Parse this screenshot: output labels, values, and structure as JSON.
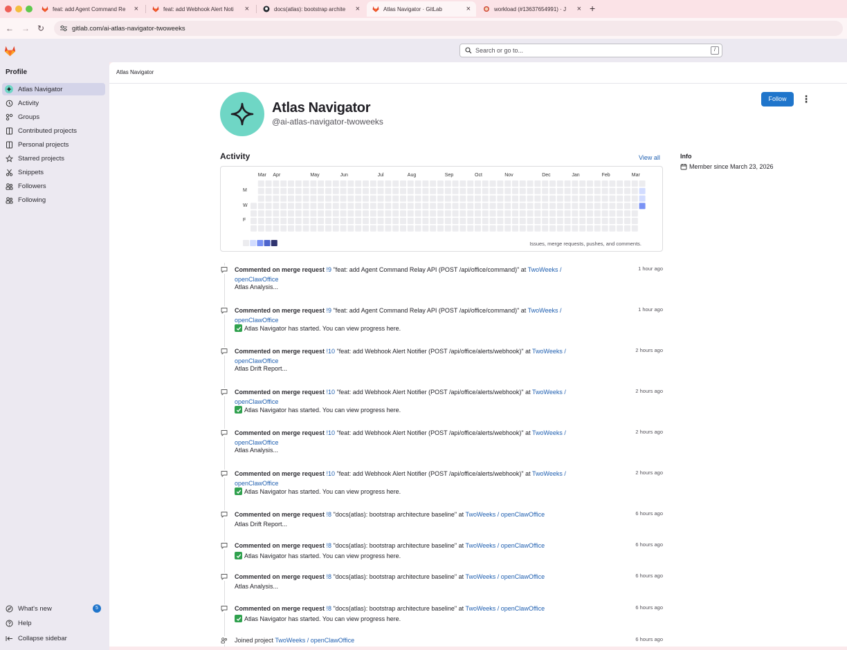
{
  "browser": {
    "tabs": [
      {
        "title": "feat: add Agent Command Re",
        "active": false
      },
      {
        "title": "feat: add Webhook Alert Noti",
        "active": false
      },
      {
        "title": "docs(atlas): bootstrap archite",
        "active": false
      },
      {
        "title": "Atlas Navigator · GitLab",
        "active": true
      },
      {
        "title": "workload (#13637654991) · J",
        "active": false
      }
    ],
    "new_tab": "+",
    "close_glyph": "×",
    "back": "←",
    "forward": "→",
    "reload": "↻",
    "url": "gitlab.com/ai-atlas-navigator-twoweeks"
  },
  "topbar": {
    "search_placeholder": "Search or go to...",
    "search_shortcut": "/"
  },
  "sidebar": {
    "heading": "Profile",
    "items": [
      {
        "label": "Atlas Navigator",
        "icon": "atlas-avatar-icon",
        "active": true
      },
      {
        "label": "Activity",
        "icon": "history-icon"
      },
      {
        "label": "Groups",
        "icon": "group-icon"
      },
      {
        "label": "Contributed projects",
        "icon": "project-icon"
      },
      {
        "label": "Personal projects",
        "icon": "project-icon"
      },
      {
        "label": "Starred projects",
        "icon": "star-icon"
      },
      {
        "label": "Snippets",
        "icon": "snippet-icon"
      },
      {
        "label": "Followers",
        "icon": "users-icon"
      },
      {
        "label": "Following",
        "icon": "users-icon"
      }
    ],
    "bottom": [
      {
        "label": "What's new",
        "icon": "compass-icon",
        "badge": "5"
      },
      {
        "label": "Help",
        "icon": "help-icon"
      },
      {
        "label": "Collapse sidebar",
        "icon": "collapse-icon"
      }
    ]
  },
  "breadcrumb": "Atlas Navigator",
  "profile": {
    "name": "Atlas Navigator",
    "handle": "@ai-atlas-navigator-twoweeks",
    "follow_label": "Follow",
    "more_glyph": "⋮",
    "avatar_color": "#6fd6c5"
  },
  "activity": {
    "title": "Activity",
    "view_all": "View all",
    "calendar": {
      "months": [
        "Mar",
        "Apr",
        "May",
        "Jun",
        "Jul",
        "Aug",
        "Sep",
        "Oct",
        "Nov",
        "Dec",
        "Jan",
        "Feb",
        "Mar"
      ],
      "day_labels": [
        "M",
        "W",
        "F"
      ],
      "legend_text": "Issues, merge requests, pushes, and comments.",
      "legend_colors": [
        "#ececef",
        "#d2dcff",
        "#7992f5",
        "#4e65cd",
        "#303470"
      ],
      "empty_color": "#ececef",
      "last_week_levels": [
        0,
        1,
        1,
        2,
        0,
        0,
        0
      ]
    }
  },
  "info": {
    "title": "Info",
    "member_since": "Member since March 23, 2026"
  },
  "events": [
    {
      "action": "Commented on merge request",
      "ref": "!9",
      "title": "\"feat: add Agent Command Relay API (POST /api/office/command)\"",
      "at": "at",
      "project": "TwoWeeks / openClawOffice",
      "time": "1 hour ago",
      "note": "Atlas Analysis...",
      "check": false
    },
    {
      "action": "Commented on merge request",
      "ref": "!9",
      "title": "\"feat: add Agent Command Relay API (POST /api/office/command)\"",
      "at": "at",
      "project": "TwoWeeks / openClawOffice",
      "time": "1 hour ago",
      "note": "Atlas Navigator has started. You can view progress here.",
      "check": true
    },
    {
      "action": "Commented on merge request",
      "ref": "!10",
      "title": "\"feat: add Webhook Alert Notifier (POST /api/office/alerts/webhook)\"",
      "at": "at",
      "project": "TwoWeeks / openClawOffice",
      "time": "2 hours ago",
      "note": "Atlas Drift Report...",
      "check": false
    },
    {
      "action": "Commented on merge request",
      "ref": "!10",
      "title": "\"feat: add Webhook Alert Notifier (POST /api/office/alerts/webhook)\"",
      "at": "at",
      "project": "TwoWeeks / openClawOffice",
      "time": "2 hours ago",
      "note": "Atlas Navigator has started. You can view progress here.",
      "check": true
    },
    {
      "action": "Commented on merge request",
      "ref": "!10",
      "title": "\"feat: add Webhook Alert Notifier (POST /api/office/alerts/webhook)\"",
      "at": "at",
      "project": "TwoWeeks / openClawOffice",
      "time": "2 hours ago",
      "note": "Atlas Analysis...",
      "check": false
    },
    {
      "action": "Commented on merge request",
      "ref": "!10",
      "title": "\"feat: add Webhook Alert Notifier (POST /api/office/alerts/webhook)\"",
      "at": "at",
      "project": "TwoWeeks / openClawOffice",
      "time": "2 hours ago",
      "note": "Atlas Navigator has started. You can view progress here.",
      "check": true
    },
    {
      "action": "Commented on merge request",
      "ref": "!8",
      "title": "\"docs(atlas): bootstrap architecture baseline\"",
      "at": "at",
      "project": "TwoWeeks / openClawOffice",
      "time": "6 hours ago",
      "note": "Atlas Drift Report...",
      "check": false
    },
    {
      "action": "Commented on merge request",
      "ref": "!8",
      "title": "\"docs(atlas): bootstrap architecture baseline\"",
      "at": "at",
      "project": "TwoWeeks / openClawOffice",
      "time": "6 hours ago",
      "note": "Atlas Navigator has started. You can view progress here.",
      "check": true
    },
    {
      "action": "Commented on merge request",
      "ref": "!8",
      "title": "\"docs(atlas): bootstrap architecture baseline\"",
      "at": "at",
      "project": "TwoWeeks / openClawOffice",
      "time": "6 hours ago",
      "note": "Atlas Analysis...",
      "check": false
    },
    {
      "action": "Commented on merge request",
      "ref": "!8",
      "title": "\"docs(atlas): bootstrap architecture baseline\"",
      "at": "at",
      "project": "TwoWeeks / openClawOffice",
      "time": "6 hours ago",
      "note": "Atlas Navigator has started. You can view progress here.",
      "check": true
    }
  ],
  "joined_event": {
    "action": "Joined project",
    "project": "TwoWeeks / openClawOffice",
    "time": "6 hours ago"
  },
  "colors": {
    "link": "#1f5fb0",
    "follow_button": "#1f75cb",
    "badge": "#1f75cb",
    "check": "#30a14e"
  }
}
